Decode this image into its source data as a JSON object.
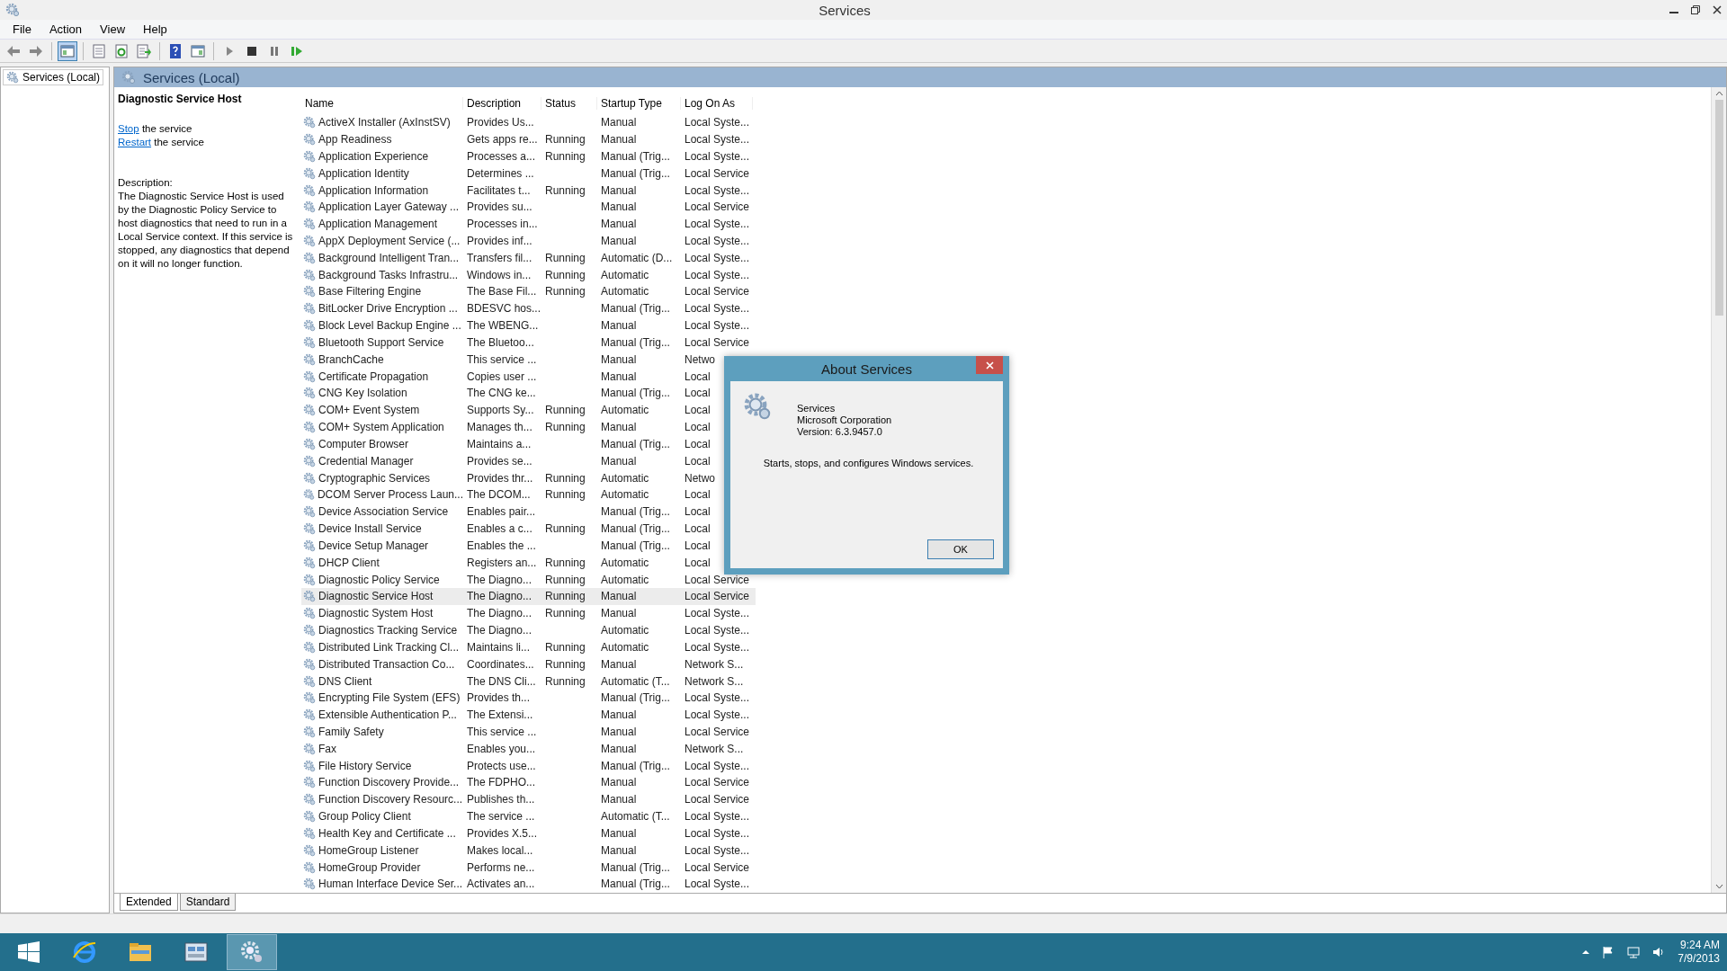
{
  "window": {
    "title": "Services"
  },
  "menu": [
    "File",
    "Action",
    "View",
    "Help"
  ],
  "toolbar": [
    {
      "kind": "back",
      "pressed": false
    },
    {
      "kind": "forward",
      "pressed": false
    },
    {
      "kind": "separator"
    },
    {
      "kind": "tree",
      "pressed": true
    },
    {
      "kind": "separator"
    },
    {
      "kind": "properties",
      "pressed": false
    },
    {
      "kind": "refresh",
      "pressed": false
    },
    {
      "kind": "export",
      "pressed": false
    },
    {
      "kind": "separator"
    },
    {
      "kind": "help",
      "pressed": false
    },
    {
      "kind": "actionpane",
      "pressed": false
    },
    {
      "kind": "separator"
    },
    {
      "kind": "start",
      "pressed": false
    },
    {
      "kind": "stop",
      "pressed": false
    },
    {
      "kind": "pause",
      "pressed": false
    },
    {
      "kind": "resume",
      "pressed": false
    }
  ],
  "tree": {
    "items": [
      {
        "label": "Services (Local)",
        "selected": true
      }
    ]
  },
  "pane_header": "Services (Local)",
  "details": {
    "title": "Diagnostic Service Host",
    "actions": [
      {
        "link": "Stop",
        "text": "the service"
      },
      {
        "link": "Restart",
        "text": "the service"
      }
    ],
    "description_label": "Description:",
    "description": "The Diagnostic Service Host is used by the Diagnostic Policy Service to host diagnostics that need to run in a Local Service context.  If this service is stopped, any diagnostics that depend on it will no longer function."
  },
  "table": {
    "columns": [
      "Name",
      "Description",
      "Status",
      "Startup Type",
      "Log On As"
    ],
    "rows": [
      {
        "name": "ActiveX Installer (AxInstSV)",
        "description": "Provides Us...",
        "status": "",
        "startup": "Manual",
        "logon": "Local Syste...",
        "selected": false
      },
      {
        "name": "App Readiness",
        "description": "Gets apps re...",
        "status": "Running",
        "startup": "Manual",
        "logon": "Local Syste...",
        "selected": false
      },
      {
        "name": "Application Experience",
        "description": "Processes a...",
        "status": "Running",
        "startup": "Manual (Trig...",
        "logon": "Local Syste...",
        "selected": false
      },
      {
        "name": "Application Identity",
        "description": "Determines ...",
        "status": "",
        "startup": "Manual (Trig...",
        "logon": "Local Service",
        "selected": false
      },
      {
        "name": "Application Information",
        "description": "Facilitates t...",
        "status": "Running",
        "startup": "Manual",
        "logon": "Local Syste...",
        "selected": false
      },
      {
        "name": "Application Layer Gateway ...",
        "description": "Provides su...",
        "status": "",
        "startup": "Manual",
        "logon": "Local Service",
        "selected": false
      },
      {
        "name": "Application Management",
        "description": "Processes in...",
        "status": "",
        "startup": "Manual",
        "logon": "Local Syste...",
        "selected": false
      },
      {
        "name": "AppX Deployment Service (...",
        "description": "Provides inf...",
        "status": "",
        "startup": "Manual",
        "logon": "Local Syste...",
        "selected": false
      },
      {
        "name": "Background Intelligent Tran...",
        "description": "Transfers fil...",
        "status": "Running",
        "startup": "Automatic (D...",
        "logon": "Local Syste...",
        "selected": false
      },
      {
        "name": "Background Tasks Infrastru...",
        "description": "Windows in...",
        "status": "Running",
        "startup": "Automatic",
        "logon": "Local Syste...",
        "selected": false
      },
      {
        "name": "Base Filtering Engine",
        "description": "The Base Fil...",
        "status": "Running",
        "startup": "Automatic",
        "logon": "Local Service",
        "selected": false
      },
      {
        "name": "BitLocker Drive Encryption ...",
        "description": "BDESVC hos...",
        "status": "",
        "startup": "Manual (Trig...",
        "logon": "Local Syste...",
        "selected": false
      },
      {
        "name": "Block Level Backup Engine ...",
        "description": "The WBENG...",
        "status": "",
        "startup": "Manual",
        "logon": "Local Syste...",
        "selected": false
      },
      {
        "name": "Bluetooth Support Service",
        "description": "The Bluetoo...",
        "status": "",
        "startup": "Manual (Trig...",
        "logon": "Local Service",
        "selected": false
      },
      {
        "name": "BranchCache",
        "description": "This service ...",
        "status": "",
        "startup": "Manual",
        "logon": "Netwo",
        "selected": false
      },
      {
        "name": "Certificate Propagation",
        "description": "Copies user ...",
        "status": "",
        "startup": "Manual",
        "logon": "Local",
        "selected": false
      },
      {
        "name": "CNG Key Isolation",
        "description": "The CNG ke...",
        "status": "",
        "startup": "Manual (Trig...",
        "logon": "Local",
        "selected": false
      },
      {
        "name": "COM+ Event System",
        "description": "Supports Sy...",
        "status": "Running",
        "startup": "Automatic",
        "logon": "Local",
        "selected": false
      },
      {
        "name": "COM+ System Application",
        "description": "Manages th...",
        "status": "Running",
        "startup": "Manual",
        "logon": "Local",
        "selected": false
      },
      {
        "name": "Computer Browser",
        "description": "Maintains a...",
        "status": "",
        "startup": "Manual (Trig...",
        "logon": "Local",
        "selected": false
      },
      {
        "name": "Credential Manager",
        "description": "Provides se...",
        "status": "",
        "startup": "Manual",
        "logon": "Local",
        "selected": false
      },
      {
        "name": "Cryptographic Services",
        "description": "Provides thr...",
        "status": "Running",
        "startup": "Automatic",
        "logon": "Netwo",
        "selected": false
      },
      {
        "name": "DCOM Server Process Laun...",
        "description": "The DCOM...",
        "status": "Running",
        "startup": "Automatic",
        "logon": "Local",
        "selected": false
      },
      {
        "name": "Device Association Service",
        "description": "Enables pair...",
        "status": "",
        "startup": "Manual (Trig...",
        "logon": "Local",
        "selected": false
      },
      {
        "name": "Device Install Service",
        "description": "Enables a c...",
        "status": "Running",
        "startup": "Manual (Trig...",
        "logon": "Local",
        "selected": false
      },
      {
        "name": "Device Setup Manager",
        "description": "Enables the ...",
        "status": "",
        "startup": "Manual (Trig...",
        "logon": "Local",
        "selected": false
      },
      {
        "name": "DHCP Client",
        "description": "Registers an...",
        "status": "Running",
        "startup": "Automatic",
        "logon": "Local",
        "selected": false
      },
      {
        "name": "Diagnostic Policy Service",
        "description": "The Diagno...",
        "status": "Running",
        "startup": "Automatic",
        "logon": "Local Service",
        "selected": false
      },
      {
        "name": "Diagnostic Service Host",
        "description": "The Diagno...",
        "status": "Running",
        "startup": "Manual",
        "logon": "Local Service",
        "selected": true
      },
      {
        "name": "Diagnostic System Host",
        "description": "The Diagno...",
        "status": "Running",
        "startup": "Manual",
        "logon": "Local Syste...",
        "selected": false
      },
      {
        "name": "Diagnostics Tracking Service",
        "description": "The Diagno...",
        "status": "",
        "startup": "Automatic",
        "logon": "Local Syste...",
        "selected": false
      },
      {
        "name": "Distributed Link Tracking Cl...",
        "description": "Maintains li...",
        "status": "Running",
        "startup": "Automatic",
        "logon": "Local Syste...",
        "selected": false
      },
      {
        "name": "Distributed Transaction Co...",
        "description": "Coordinates...",
        "status": "Running",
        "startup": "Manual",
        "logon": "Network S...",
        "selected": false
      },
      {
        "name": "DNS Client",
        "description": "The DNS Cli...",
        "status": "Running",
        "startup": "Automatic (T...",
        "logon": "Network S...",
        "selected": false
      },
      {
        "name": "Encrypting File System (EFS)",
        "description": "Provides th...",
        "status": "",
        "startup": "Manual (Trig...",
        "logon": "Local Syste...",
        "selected": false
      },
      {
        "name": "Extensible Authentication P...",
        "description": "The Extensi...",
        "status": "",
        "startup": "Manual",
        "logon": "Local Syste...",
        "selected": false
      },
      {
        "name": "Family Safety",
        "description": "This service ...",
        "status": "",
        "startup": "Manual",
        "logon": "Local Service",
        "selected": false
      },
      {
        "name": "Fax",
        "description": "Enables you...",
        "status": "",
        "startup": "Manual",
        "logon": "Network S...",
        "selected": false
      },
      {
        "name": "File History Service",
        "description": "Protects use...",
        "status": "",
        "startup": "Manual (Trig...",
        "logon": "Local Syste...",
        "selected": false
      },
      {
        "name": "Function Discovery Provide...",
        "description": "The FDPHO...",
        "status": "",
        "startup": "Manual",
        "logon": "Local Service",
        "selected": false
      },
      {
        "name": "Function Discovery Resourc...",
        "description": "Publishes th...",
        "status": "",
        "startup": "Manual",
        "logon": "Local Service",
        "selected": false
      },
      {
        "name": "Group Policy Client",
        "description": "The service ...",
        "status": "",
        "startup": "Automatic (T...",
        "logon": "Local Syste...",
        "selected": false
      },
      {
        "name": "Health Key and Certificate ...",
        "description": "Provides X.5...",
        "status": "",
        "startup": "Manual",
        "logon": "Local Syste...",
        "selected": false
      },
      {
        "name": "HomeGroup Listener",
        "description": "Makes local...",
        "status": "",
        "startup": "Manual",
        "logon": "Local Syste...",
        "selected": false
      },
      {
        "name": "HomeGroup Provider",
        "description": "Performs ne...",
        "status": "",
        "startup": "Manual (Trig...",
        "logon": "Local Service",
        "selected": false
      },
      {
        "name": "Human Interface Device Ser...",
        "description": "Activates an...",
        "status": "",
        "startup": "Manual (Trig...",
        "logon": "Local Syste...",
        "selected": false
      }
    ]
  },
  "view_tabs": [
    {
      "label": "Extended",
      "selected": true
    },
    {
      "label": "Standard",
      "selected": false
    }
  ],
  "dialog": {
    "title": "About Services",
    "product": "Services",
    "company": "Microsoft Corporation",
    "version": "Version: 6.3.9457.0",
    "summary": "Starts, stops, and configures Windows services.",
    "button": "OK"
  },
  "taskbar": {
    "items": [
      {
        "kind": "start",
        "selected": false
      },
      {
        "kind": "browser",
        "selected": false
      },
      {
        "kind": "explorer",
        "selected": false
      },
      {
        "kind": "servermanager",
        "selected": false
      },
      {
        "kind": "services",
        "selected": true
      }
    ],
    "time": "9:24 AM",
    "date": "7/9/2013"
  }
}
